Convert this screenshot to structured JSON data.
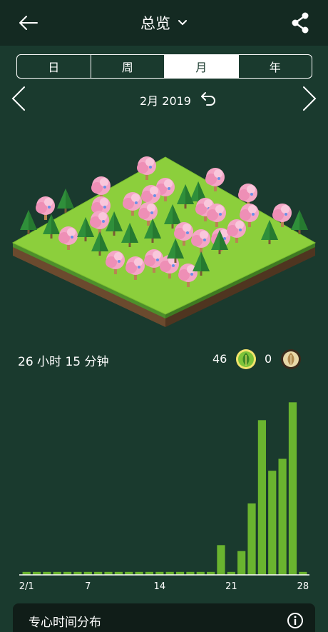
{
  "header": {
    "title": "总览",
    "back_icon": "arrow-left-icon",
    "dropdown_icon": "chevron-down-icon",
    "share_icon": "share-icon"
  },
  "tabs": [
    {
      "label": "日",
      "active": false
    },
    {
      "label": "周",
      "active": false
    },
    {
      "label": "月",
      "active": true
    },
    {
      "label": "年",
      "active": false
    }
  ],
  "date_nav": {
    "label": "2月 2019",
    "prev_icon": "chevron-left-icon",
    "next_icon": "chevron-right-icon",
    "undo_icon": "undo-icon"
  },
  "summary": {
    "total_time": "26 小时 15 分钟",
    "healthy_count": "46",
    "dead_count": "0"
  },
  "colors": {
    "background": "#1a3a2e",
    "bar": "#6ab42f",
    "axis": "#ffffff",
    "cherry": "#f4a6c6"
  },
  "chart_data": {
    "type": "bar",
    "x": [
      1,
      2,
      3,
      4,
      5,
      6,
      7,
      8,
      9,
      10,
      11,
      12,
      13,
      14,
      15,
      16,
      17,
      18,
      19,
      20,
      21,
      22,
      23,
      24,
      25,
      26,
      27,
      28
    ],
    "values": [
      0.1,
      0.1,
      0.1,
      0.1,
      0.1,
      0.1,
      0.1,
      0.1,
      0.1,
      0.1,
      0.1,
      0.1,
      0.1,
      0.1,
      0.1,
      0.1,
      0.1,
      0.1,
      0.1,
      1.0,
      0.1,
      0.8,
      2.4,
      5.2,
      3.5,
      3.9,
      5.8,
      0.1
    ],
    "tick_labels": [
      "2/1",
      "7",
      "14",
      "21",
      "28"
    ],
    "tick_positions": [
      1,
      7,
      14,
      21,
      28
    ],
    "ylim": [
      0,
      6
    ]
  },
  "bottom_card": {
    "title": "专心时间分布",
    "info_icon": "info-icon"
  }
}
